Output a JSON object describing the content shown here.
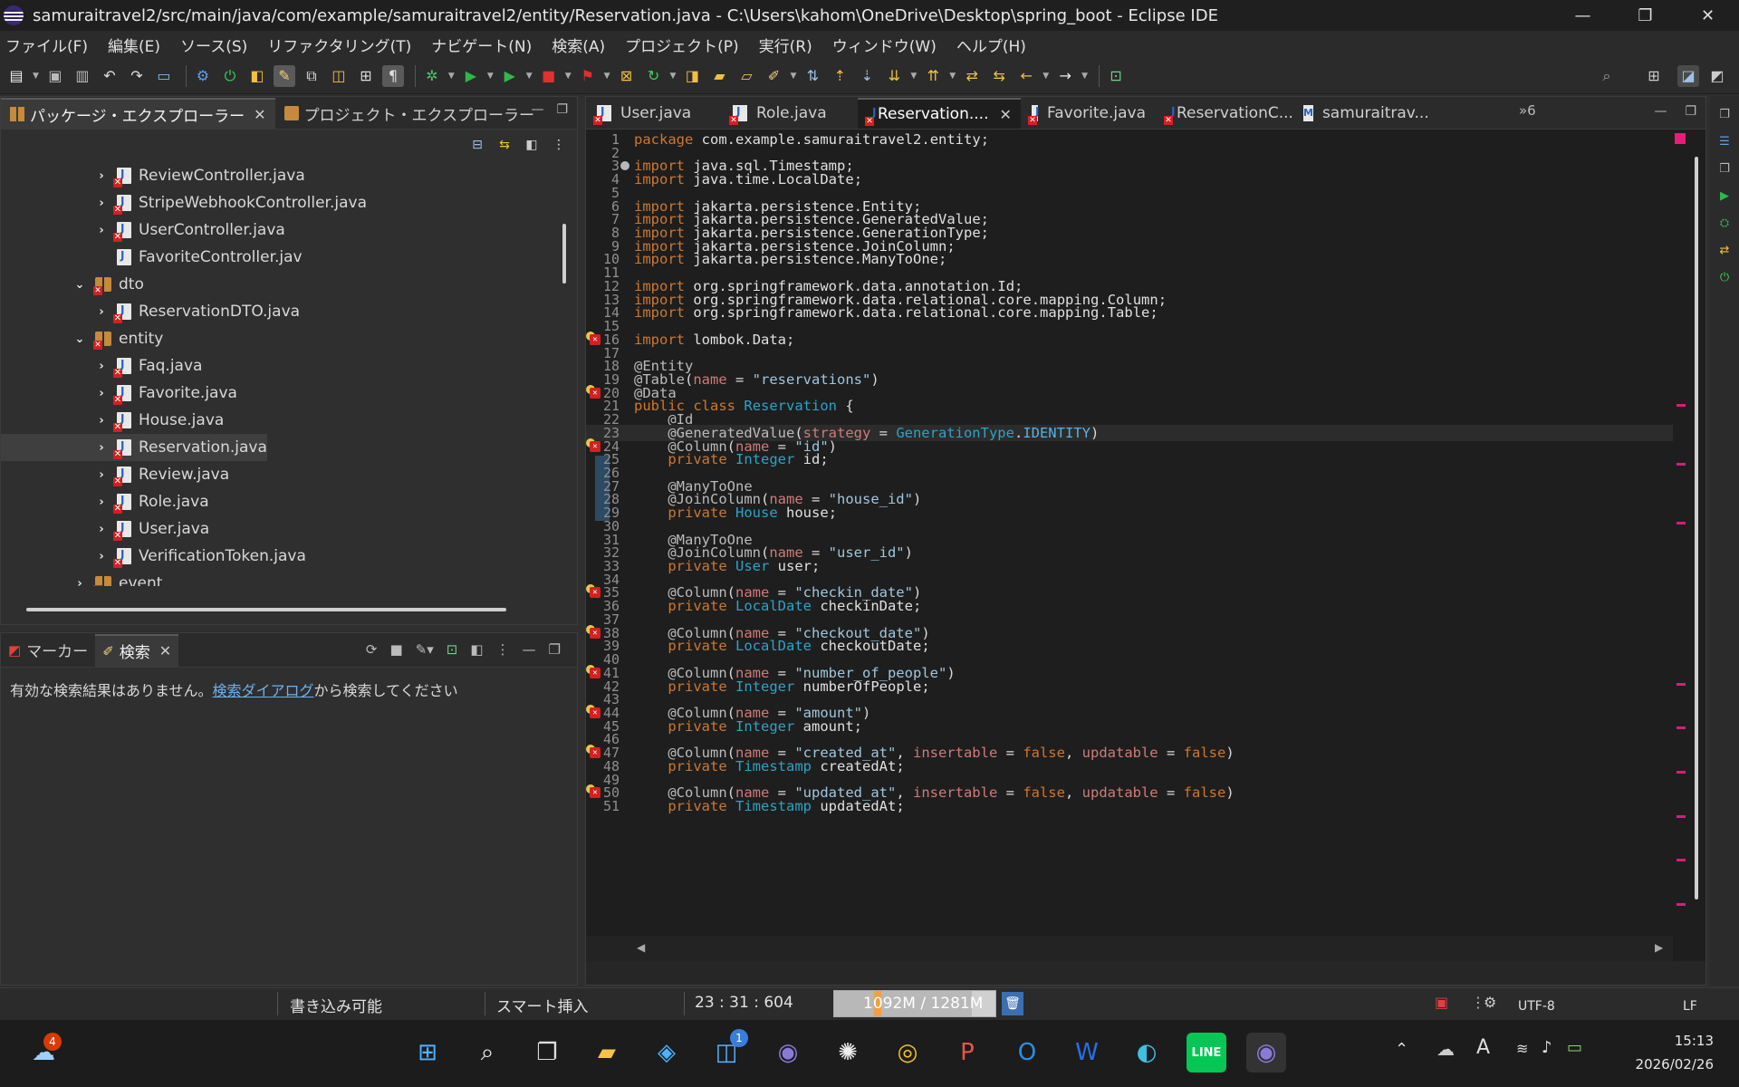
{
  "window": {
    "title": "samuraitravel2/src/main/java/com/example/samuraitravel2/entity/Reservation.java - C:\\Users\\kahom\\OneDrive\\Desktop\\spring_boot - Eclipse IDE",
    "minimize": "—",
    "maximize": "❐",
    "close": "✕"
  },
  "menu": [
    "ファイル(F)",
    "編集(E)",
    "ソース(S)",
    "リファクタリング(T)",
    "ナビゲート(N)",
    "検索(A)",
    "プロジェクト(P)",
    "実行(R)",
    "ウィンドウ(W)",
    "ヘルプ(H)"
  ],
  "left_pane": {
    "tabs": [
      {
        "label": "パッケージ・エクスプローラー",
        "active": true
      },
      {
        "label": "プロジェクト・エクスプローラー",
        "active": false
      }
    ],
    "tree": [
      {
        "label": "ReviewController.java",
        "kind": "file",
        "indent": 2,
        "chevron": "›",
        "error": true
      },
      {
        "label": "StripeWebhookController.java",
        "kind": "file",
        "indent": 2,
        "chevron": "›",
        "error": true
      },
      {
        "label": "UserController.java",
        "kind": "file",
        "indent": 2,
        "chevron": "›",
        "error": true
      },
      {
        "label": "FavoriteController.jav",
        "kind": "file",
        "indent": 2,
        "chevron": "",
        "error": false
      },
      {
        "label": "dto",
        "kind": "package",
        "indent": 1,
        "chevron": "⌄",
        "error": true
      },
      {
        "label": "ReservationDTO.java",
        "kind": "file",
        "indent": 2,
        "chevron": "›",
        "error": true
      },
      {
        "label": "entity",
        "kind": "package",
        "indent": 1,
        "chevron": "⌄",
        "error": true
      },
      {
        "label": "Faq.java",
        "kind": "file",
        "indent": 2,
        "chevron": "›",
        "error": true
      },
      {
        "label": "Favorite.java",
        "kind": "file",
        "indent": 2,
        "chevron": "›",
        "error": true
      },
      {
        "label": "House.java",
        "kind": "file",
        "indent": 2,
        "chevron": "›",
        "error": true
      },
      {
        "label": "Reservation.java",
        "kind": "file",
        "indent": 2,
        "chevron": "›",
        "error": true,
        "selected": true
      },
      {
        "label": "Review.java",
        "kind": "file",
        "indent": 2,
        "chevron": "›",
        "error": true
      },
      {
        "label": "Role.java",
        "kind": "file",
        "indent": 2,
        "chevron": "›",
        "error": true
      },
      {
        "label": "User.java",
        "kind": "file",
        "indent": 2,
        "chevron": "›",
        "error": true
      },
      {
        "label": "VerificationToken.java",
        "kind": "file",
        "indent": 2,
        "chevron": "›",
        "error": true
      },
      {
        "label": "event",
        "kind": "package",
        "indent": 1,
        "chevron": "›",
        "error": true
      }
    ]
  },
  "bottom_pane": {
    "tabs": [
      {
        "label": "マーカー",
        "active": false
      },
      {
        "label": "検索",
        "active": true
      }
    ],
    "message_before": "有効な検索結果はありません。",
    "message_link": "検索ダイアログ",
    "message_after": "から検索してください"
  },
  "editor": {
    "tabs": [
      {
        "label": "User.java",
        "active": false,
        "icon": "java"
      },
      {
        "label": "Role.java",
        "active": false,
        "icon": "java"
      },
      {
        "label": "Reservation....",
        "active": true,
        "icon": "java"
      },
      {
        "label": "Favorite.java",
        "active": false,
        "icon": "java"
      },
      {
        "label": "ReservationC...",
        "active": false,
        "icon": "java"
      },
      {
        "label": "samuraitrav...",
        "active": false,
        "icon": "md"
      }
    ],
    "overflow_label": "»6",
    "lines": [
      {
        "n": "1",
        "t": "package com.example.samuraitravel2.entity;"
      },
      {
        "n": "2",
        "t": ""
      },
      {
        "n": "3",
        "t": "import java.sql.Timestamp;",
        "fold": true
      },
      {
        "n": "4",
        "t": "import java.time.LocalDate;"
      },
      {
        "n": "5",
        "t": ""
      },
      {
        "n": "6",
        "t": "import jakarta.persistence.Entity;"
      },
      {
        "n": "7",
        "t": "import jakarta.persistence.GeneratedValue;"
      },
      {
        "n": "8",
        "t": "import jakarta.persistence.GenerationType;"
      },
      {
        "n": "9",
        "t": "import jakarta.persistence.JoinColumn;"
      },
      {
        "n": "10",
        "t": "import jakarta.persistence.ManyToOne;"
      },
      {
        "n": "11",
        "t": ""
      },
      {
        "n": "12",
        "t": "import org.springframework.data.annotation.Id;"
      },
      {
        "n": "13",
        "t": "import org.springframework.data.relational.core.mapping.Column;"
      },
      {
        "n": "14",
        "t": "import org.springframework.data.relational.core.mapping.Table;"
      },
      {
        "n": "15",
        "t": ""
      },
      {
        "n": "16",
        "t": "import lombok.Data;",
        "err": true
      },
      {
        "n": "17",
        "t": ""
      },
      {
        "n": "18",
        "t": "@Entity"
      },
      {
        "n": "19",
        "t": "@Table(name = \"reservations\")"
      },
      {
        "n": "20",
        "t": "@Data",
        "err": true
      },
      {
        "n": "21",
        "t": "public class Reservation {"
      },
      {
        "n": "22",
        "t": "    @Id"
      },
      {
        "n": "23",
        "t": "    @GeneratedValue(strategy = GenerationType.IDENTITY)",
        "current": true
      },
      {
        "n": "24",
        "t": "    @Column(name = \"id\")",
        "err": true
      },
      {
        "n": "25",
        "t": "    private Integer id;"
      },
      {
        "n": "26",
        "t": ""
      },
      {
        "n": "27",
        "t": "    @ManyToOne"
      },
      {
        "n": "28",
        "t": "    @JoinColumn(name = \"house_id\")"
      },
      {
        "n": "29",
        "t": "    private House house;"
      },
      {
        "n": "30",
        "t": ""
      },
      {
        "n": "31",
        "t": "    @ManyToOne"
      },
      {
        "n": "32",
        "t": "    @JoinColumn(name = \"user_id\")"
      },
      {
        "n": "33",
        "t": "    private User user;"
      },
      {
        "n": "34",
        "t": ""
      },
      {
        "n": "35",
        "t": "    @Column(name = \"checkin_date\")",
        "err": true
      },
      {
        "n": "36",
        "t": "    private LocalDate checkinDate;"
      },
      {
        "n": "37",
        "t": ""
      },
      {
        "n": "38",
        "t": "    @Column(name = \"checkout_date\")",
        "err": true
      },
      {
        "n": "39",
        "t": "    private LocalDate checkoutDate;"
      },
      {
        "n": "40",
        "t": ""
      },
      {
        "n": "41",
        "t": "    @Column(name = \"number_of_people\")",
        "err": true
      },
      {
        "n": "42",
        "t": "    private Integer numberOfPeople;"
      },
      {
        "n": "43",
        "t": ""
      },
      {
        "n": "44",
        "t": "    @Column(name = \"amount\")",
        "err": true
      },
      {
        "n": "45",
        "t": "    private Integer amount;"
      },
      {
        "n": "46",
        "t": ""
      },
      {
        "n": "47",
        "t": "    @Column(name = \"created_at\", insertable = false, updatable = false)",
        "err": true
      },
      {
        "n": "48",
        "t": "    private Timestamp createdAt;"
      },
      {
        "n": "49",
        "t": ""
      },
      {
        "n": "50",
        "t": "    @Column(name = \"updated_at\", insertable = false, updatable = false)",
        "err": true
      },
      {
        "n": "51",
        "t": "    private Timestamp updatedAt;"
      }
    ]
  },
  "status": {
    "writable": "書き込み可能",
    "insert_mode": "スマート挿入",
    "position": "23 : 31 : 604",
    "heap": "1092M / 1281M",
    "heap_used_fraction": 0.853,
    "encoding": "UTF-8",
    "line_ending": "LF"
  },
  "taskbar": {
    "weather_badge": "4",
    "store_badge": "1",
    "time": "15:13",
    "date": "2026/02/26"
  }
}
